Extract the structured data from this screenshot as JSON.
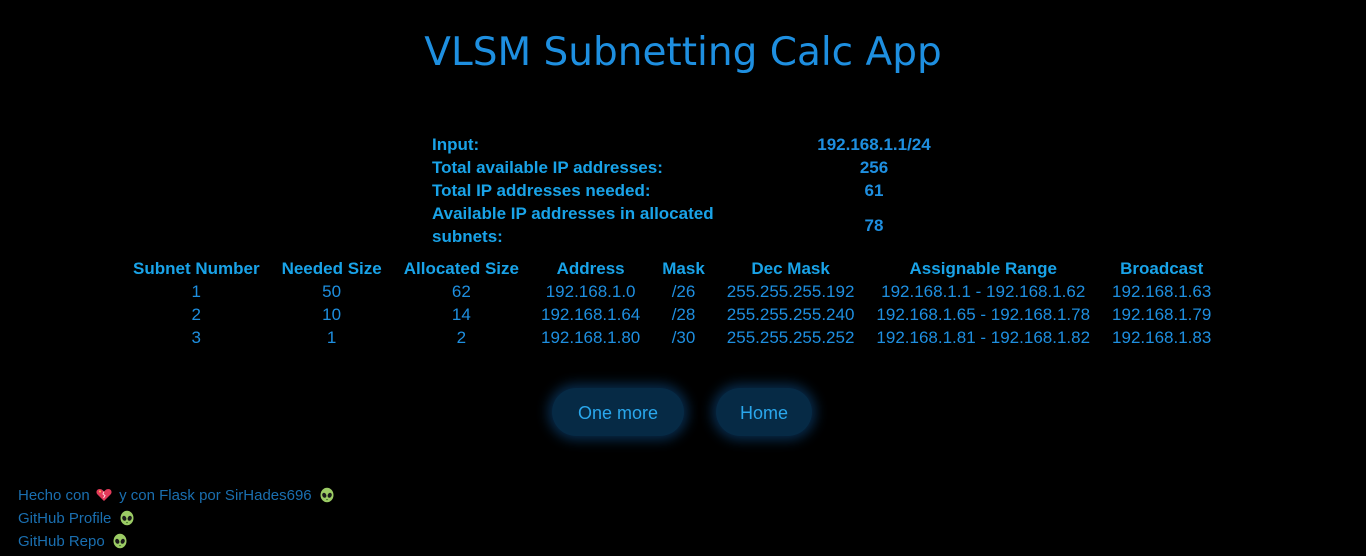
{
  "page": {
    "title": "VLSM Subnetting Calc App"
  },
  "summary": {
    "rows": [
      {
        "label": "Input:",
        "value": "192.168.1.1/24"
      },
      {
        "label": "Total available IP addresses:",
        "value": "256"
      },
      {
        "label": "Total IP addresses needed:",
        "value": "61"
      },
      {
        "label": "Available IP addresses in allocated subnets:",
        "value": "78"
      }
    ]
  },
  "results": {
    "headers": [
      "Subnet Number",
      "Needed Size",
      "Allocated Size",
      "Address",
      "Mask",
      "Dec Mask",
      "Assignable Range",
      "Broadcast"
    ],
    "rows": [
      [
        "1",
        "50",
        "62",
        "192.168.1.0",
        "/26",
        "255.255.255.192",
        "192.168.1.1 - 192.168.1.62",
        "192.168.1.63"
      ],
      [
        "2",
        "10",
        "14",
        "192.168.1.64",
        "/28",
        "255.255.255.240",
        "192.168.1.65 - 192.168.1.78",
        "192.168.1.79"
      ],
      [
        "3",
        "1",
        "2",
        "192.168.1.80",
        "/30",
        "255.255.255.252",
        "192.168.1.81 - 192.168.1.82",
        "192.168.1.83"
      ]
    ]
  },
  "buttons": {
    "one_more": "One more",
    "home": "Home"
  },
  "footer": {
    "made_with_prefix": "Hecho con",
    "made_with_suffix": "y con Flask por SirHades696",
    "github_profile": "GitHub Profile",
    "github_repo": "GitHub Repo",
    "icons": {
      "heart": "heart-icon",
      "alien": "alien-icon"
    }
  },
  "colors": {
    "background": "#000000",
    "title": "#1e8fe0",
    "label": "#19a3e8",
    "value": "#1e8fe0",
    "button_bg": "#062a45",
    "footer": "#1a6fb0"
  }
}
